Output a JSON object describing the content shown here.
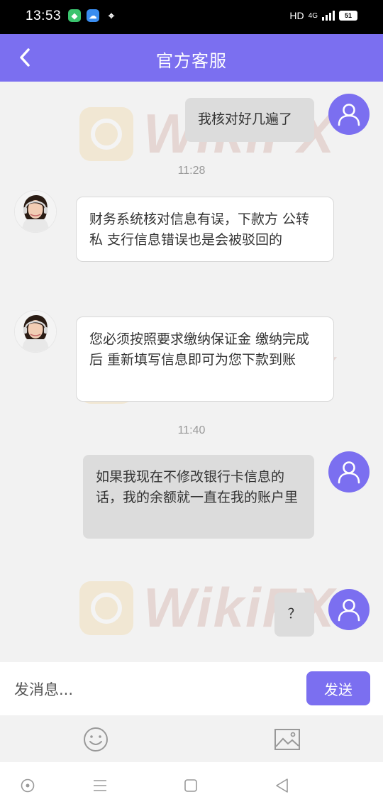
{
  "status_bar": {
    "time": "13:53",
    "network": "HD",
    "signal_label": "4G",
    "battery": "51"
  },
  "header": {
    "title": "官方客服",
    "back_icon": "chevron-left-icon"
  },
  "watermark": {
    "text": "WikiFX"
  },
  "messages": [
    {
      "side": "right",
      "text": "我核对好几遍了"
    },
    {
      "side": "time",
      "text": "11:28"
    },
    {
      "side": "left",
      "text": "财务系统核对信息有误，下款方 公转私  支行信息错误也是会被驳回的"
    },
    {
      "side": "left",
      "text": "您必须按照要求缴纳保证金 缴纳完成后 重新填写信息即可为您下款到账"
    },
    {
      "side": "time",
      "text": "11:40"
    },
    {
      "side": "right",
      "text": "如果我现在不修改银行卡信息的话，我的余额就一直在我的账户里"
    },
    {
      "side": "right",
      "text": "？"
    }
  ],
  "composer": {
    "placeholder": "发消息...",
    "send_label": "发送"
  },
  "colors": {
    "accent": "#7b6ff0",
    "bubble_self": "#dcdcdc",
    "bubble_agent": "#ffffff"
  }
}
